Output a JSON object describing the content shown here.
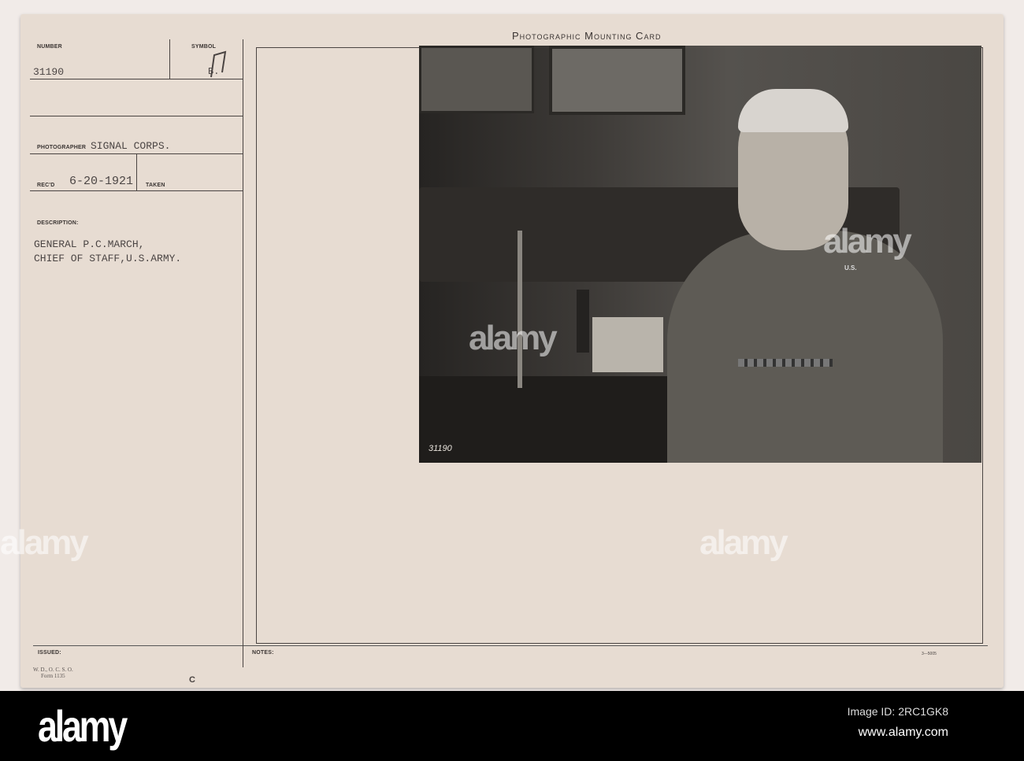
{
  "card": {
    "title": "Photographic Mounting Card",
    "number_label": "NUMBER",
    "number_value": "31190",
    "symbol_label": "SYMBOL",
    "symbol_value": "B.",
    "photographer_label": "PHOTOGRAPHER",
    "photographer_value": "SIGNAL CORPS.",
    "recd_label": "REC'D",
    "recd_value": "6-20-1921",
    "taken_label": "TAKEN",
    "description_label": "DESCRIPTION:",
    "description_lines": [
      "GENERAL P.C.MARCH,",
      "CHIEF OF STAFF,U.S.ARMY."
    ],
    "form_lines": [
      "W. D., O. C. S. O.",
      "Form 1135"
    ],
    "issued_label": "ISSUED:",
    "letter_c": "C",
    "notes_label": "NOTES:",
    "print_code": "3—5005"
  },
  "photo": {
    "caption_number": "31190",
    "collar_insignia": "U.S."
  },
  "watermark": {
    "text": "alamy",
    "logo": "alamy",
    "image_id": "Image ID: 2RC1GK8",
    "url": "www.alamy.com"
  }
}
